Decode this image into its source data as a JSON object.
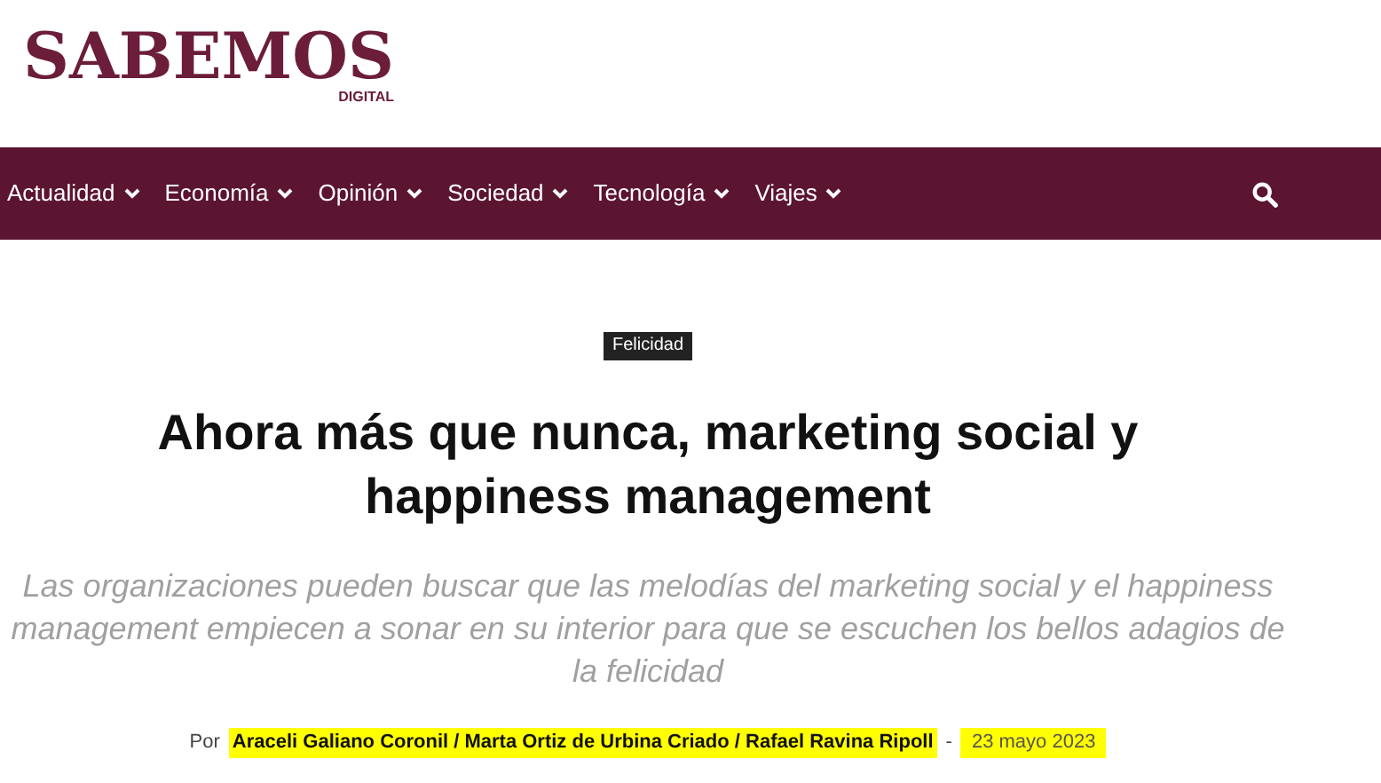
{
  "logo": {
    "name": "SABEMOS",
    "tagline": "DIGITAL"
  },
  "nav": {
    "items": [
      {
        "label": "Actualidad"
      },
      {
        "label": "Economía"
      },
      {
        "label": "Opinión"
      },
      {
        "label": "Sociedad"
      },
      {
        "label": "Tecnología"
      },
      {
        "label": "Viajes"
      }
    ]
  },
  "article": {
    "category": "Felicidad",
    "title": "Ahora más que nunca, marketing social y happiness management",
    "subtitle": "Las organizaciones pueden buscar que las melodías del marketing social y el happiness management empiecen a sonar en su interior para que se escuchen los bellos adagios de la felicidad",
    "byline": {
      "prefix": "Por",
      "authors": "Araceli Galiano Coronil / Marta Ortiz de Urbina Criado / Rafael Ravina Ripoll",
      "separator": "-",
      "date": "23 mayo 2023",
      "highlighted": true
    }
  }
}
